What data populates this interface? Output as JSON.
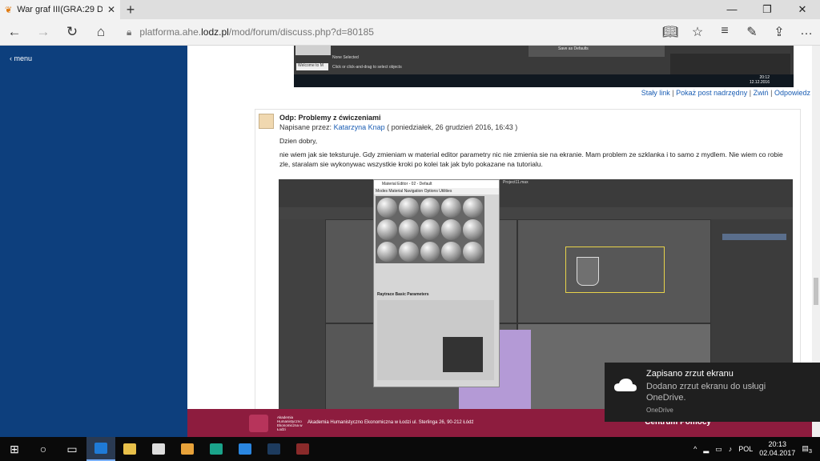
{
  "browser": {
    "tab_title": "War graf III(GRA:29 D1 S",
    "url_prefix": "platforma.ahe.",
    "url_domain": "lodz.pl",
    "url_path": "/mod/forum/discuss.php?d=80185"
  },
  "sidebar": {
    "menu_label": "menu"
  },
  "prev_screenshot": {
    "status1": "None Selected",
    "status2": "Click or click-and-drag to select objects",
    "welcome": "Welcome to M",
    "save": "Save as Defaults",
    "time": "20:12",
    "date": "12.12.2016"
  },
  "links": {
    "permalink": "Stały link",
    "parent": "Pokaż post nadrzędny",
    "collapse": "Zwiń",
    "reply": "Odpowiedz",
    "sep": "|"
  },
  "post": {
    "title": "Odp: Problemy z ćwiczeniami",
    "written_by": "Napisane przez:",
    "author": "Katarzyna Knap",
    "date": "( poniedziałek, 26 grudzień 2016, 16:43 )",
    "greeting": "Dzien dobry,",
    "body": "nie wiem jak sie teksturuje. Gdy zmieniam w material editor parametry nic nie zmienia sie na ekranie. Mam problem ze szklanka i to samo z mydlem. Nie wiem co  robie zle, staralam sie wykonywac wszystkie kroki po kolei tak jak bylo pokazane na tutorialu."
  },
  "embedded": {
    "mat_title": "Material Editor - 02 - Default",
    "mat_menu": "Modes  Material  Navigation  Options  Utilities",
    "file": "Project11.max",
    "param_header": "Raytrace Basic Parameters"
  },
  "footer": {
    "logo_text": "Akademia Humanistyczno Ekonomiczna w Łodzi",
    "address": "Akademia Humanistyczno Ekonomiczna w Łodzi ul. Sterlinga 26, 90-212 Łódź",
    "right_text": "Centrum Pomocy"
  },
  "toast": {
    "title": "Zapisano zrzut ekranu",
    "message": "Dodano zrzut ekranu do usługi OneDrive.",
    "source": "OneDrive"
  },
  "taskbar": {
    "lang": "POL",
    "time": "20:13",
    "date": "02.04.2017",
    "notif_count": "3"
  }
}
